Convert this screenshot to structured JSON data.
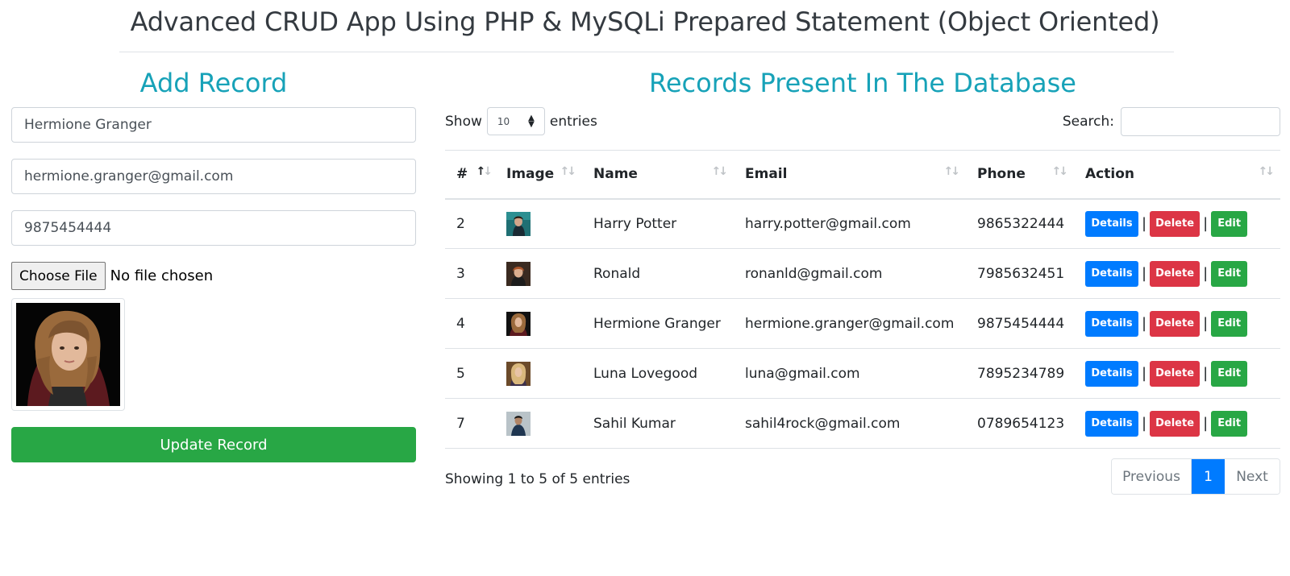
{
  "page": {
    "title": "Advanced CRUD App Using PHP & MySQLi Prepared Statement (Object Oriented)"
  },
  "form": {
    "heading": "Add Record",
    "name_value": "Hermione Granger",
    "email_value": "hermione.granger@gmail.com",
    "phone_value": "9875454444",
    "file_button": "Choose File",
    "file_status": "No file chosen",
    "submit_label": "Update Record"
  },
  "records": {
    "heading": "Records Present In The Database",
    "length_prefix": "Show",
    "length_value": "10",
    "length_suffix": "entries",
    "search_label": "Search:",
    "columns": [
      "#",
      "Image",
      "Name",
      "Email",
      "Phone",
      "Action"
    ],
    "rows": [
      {
        "id": "2",
        "name": "Harry Potter",
        "email": "harry.potter@gmail.com",
        "phone": "9865322444"
      },
      {
        "id": "3",
        "name": "Ronald",
        "email": "ronanld@gmail.com",
        "phone": "7985632451"
      },
      {
        "id": "4",
        "name": "Hermione Granger",
        "email": "hermione.granger@gmail.com",
        "phone": "9875454444"
      },
      {
        "id": "5",
        "name": "Luna Lovegood",
        "email": "luna@gmail.com",
        "phone": "7895234789"
      },
      {
        "id": "7",
        "name": "Sahil Kumar",
        "email": "sahil4rock@gmail.com",
        "phone": "0789654123"
      }
    ],
    "actions": {
      "details": "Details",
      "delete": "Delete",
      "edit": "Edit",
      "separator": "|"
    },
    "info": "Showing 1 to 5 of 5 entries",
    "pagination": {
      "previous": "Previous",
      "current": "1",
      "next": "Next"
    }
  },
  "colors": {
    "accent": "#17a2b8",
    "primary": "#007bff",
    "danger": "#dc3545",
    "success": "#28a745"
  },
  "icons": {
    "sort": "sort-arrows-icon",
    "select_caret": "select-caret-icon"
  }
}
